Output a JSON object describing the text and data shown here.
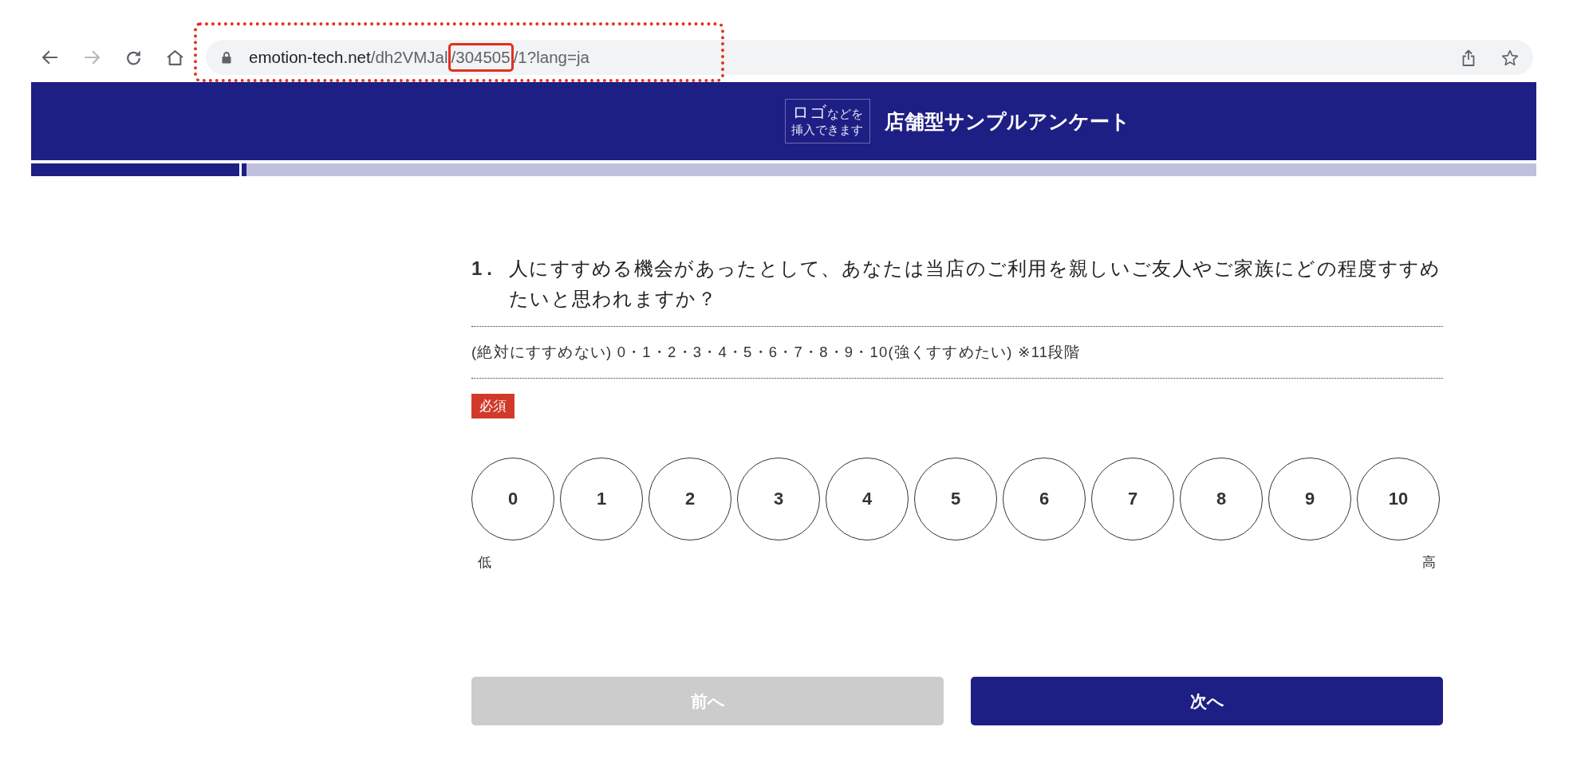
{
  "browser": {
    "nav_buttons": [
      {
        "kind": "back",
        "disabled": false
      },
      {
        "kind": "forward",
        "disabled": true
      },
      {
        "kind": "reload",
        "disabled": false
      },
      {
        "kind": "home",
        "disabled": false
      }
    ],
    "address_bar": {
      "highlighted": true,
      "url": [
        {
          "kind": "domain",
          "text": "emotion-tech.net",
          "highlighted": false
        },
        {
          "kind": "path",
          "text": "/dh2VMJal",
          "highlighted": false
        },
        {
          "kind": "path",
          "text": "/304505",
          "highlighted": true
        },
        {
          "kind": "path",
          "text": "/1?lang=ja",
          "highlighted": false
        }
      ]
    },
    "actions": [
      {
        "kind": "share"
      },
      {
        "kind": "bookmark"
      }
    ]
  },
  "header": {
    "logo_placeholder": {
      "lead": "ロゴ",
      "line_1": "などを",
      "line_2": "挿入できます"
    },
    "title": "店舗型サンプルアンケート"
  },
  "progress": {
    "level": 0.143
  },
  "question": {
    "number": "1.",
    "text": "人にすすめる機会があったとして、あなたは当店のご利用を親しいご友人やご家族にどの程度すすめたいと思われますか？",
    "scale_note": "(絶対にすすめない) 0・1・2・3・4・5・6・7・8・9・10(強くすすめたい) ※11段階",
    "required_badge": "必須",
    "options": [
      {
        "label": "0",
        "selected": false
      },
      {
        "label": "1",
        "selected": false
      },
      {
        "label": "2",
        "selected": false
      },
      {
        "label": "3",
        "selected": false
      },
      {
        "label": "4",
        "selected": false
      },
      {
        "label": "5",
        "selected": false
      },
      {
        "label": "6",
        "selected": false
      },
      {
        "label": "7",
        "selected": false
      },
      {
        "label": "8",
        "selected": false
      },
      {
        "label": "9",
        "selected": false
      },
      {
        "label": "10",
        "selected": false
      }
    ],
    "low_label": "低",
    "high_label": "高"
  },
  "buttons": [
    {
      "label": "前へ",
      "disabled": true
    },
    {
      "label": "次へ",
      "disabled": false
    }
  ]
}
